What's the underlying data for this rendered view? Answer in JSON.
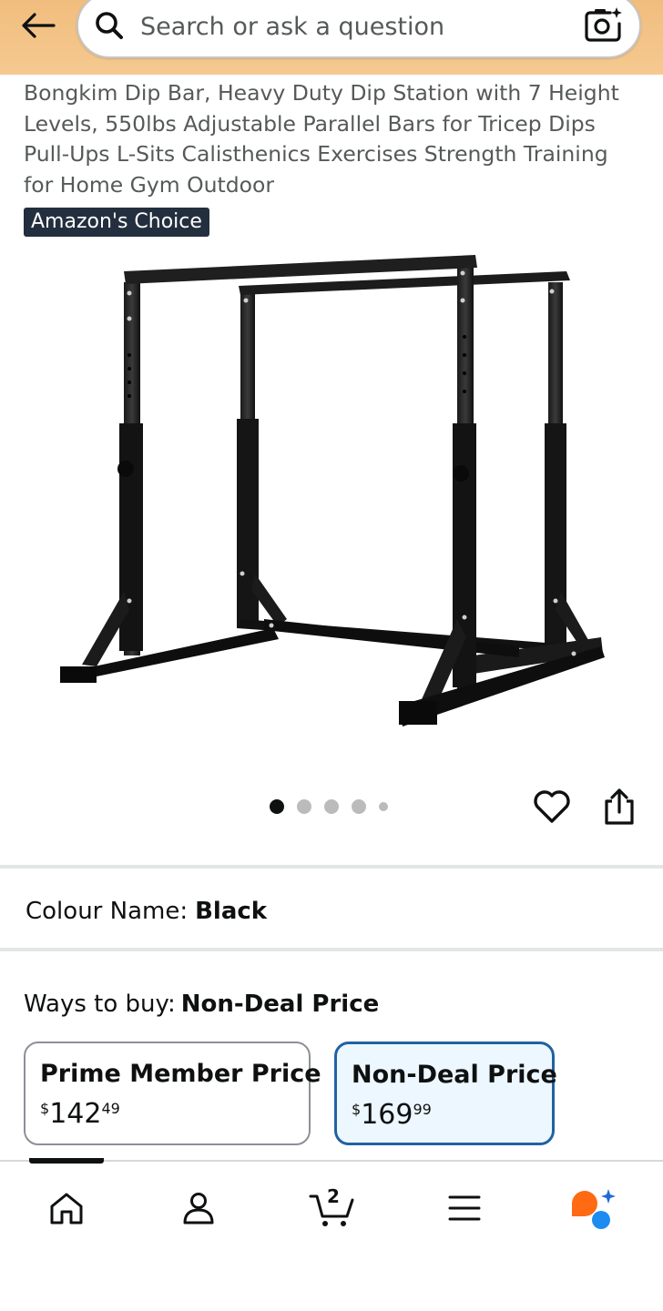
{
  "header": {
    "search_placeholder": "Search or ask a question"
  },
  "product": {
    "title": "Bongkim Dip Bar, Heavy Duty Dip Station with 7 Height Levels, 550lbs Adjustable Parallel Bars for Tricep Dips Pull-Ups L-Sits Calisthenics Exercises Strength Training for Home Gym Outdoor",
    "badge": "Amazon's Choice",
    "image_count": 5,
    "active_image": 1
  },
  "colour": {
    "label": "Colour Name:",
    "value": "Black"
  },
  "ways_to_buy": {
    "label": "Ways to buy:",
    "selected": "Non-Deal Price",
    "options": [
      {
        "title": "Prime Member Price",
        "currency": "$",
        "whole": "142",
        "cents": "49"
      },
      {
        "title": "Non-Deal Price",
        "currency": "$",
        "whole": "169",
        "cents": "99"
      }
    ]
  },
  "bottom_nav": {
    "cart_count": "2",
    "items": [
      "home-icon",
      "account-icon",
      "cart-icon",
      "menu-icon",
      "rufus-ai-icon"
    ]
  },
  "colors": {
    "header_bg": "#f3c48b",
    "badge_bg": "#232f3e",
    "selected_border": "#2162a1",
    "selected_bg": "#edf7ff"
  }
}
